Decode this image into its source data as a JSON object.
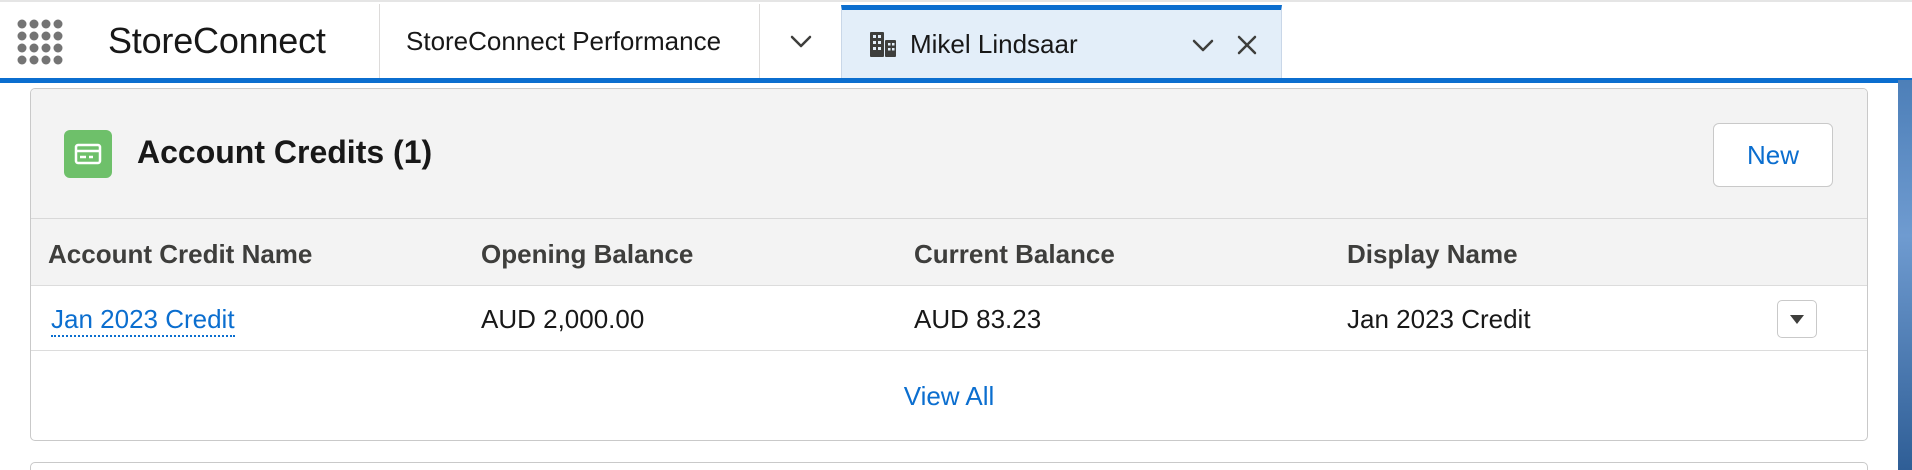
{
  "app": {
    "name": "StoreConnect",
    "launcher_icon": "app-launcher-grid-icon"
  },
  "nav": {
    "items": [
      {
        "label": "StoreConnect Performance"
      }
    ],
    "more_icon": "chevron-down-icon"
  },
  "tab": {
    "label": "Mikel Lindsaar",
    "icon": "building-icon",
    "dropdown_icon": "chevron-down-icon",
    "close_icon": "close-icon"
  },
  "card": {
    "icon": "account-credit-icon",
    "title": "Account Credits (1)",
    "new_label": "New",
    "columns": [
      "Account Credit Name",
      "Opening Balance",
      "Current Balance",
      "Display Name"
    ],
    "rows": [
      {
        "name": "Jan 2023 Credit",
        "opening_balance": "AUD 2,000.00",
        "current_balance": "AUD 83.23",
        "display_name": "Jan 2023 Credit"
      }
    ],
    "view_all_label": "View All"
  },
  "colors": {
    "brand_blue": "#0b6ecf",
    "active_tab_bg": "#e3eef9",
    "icon_green": "#6ec06a"
  }
}
